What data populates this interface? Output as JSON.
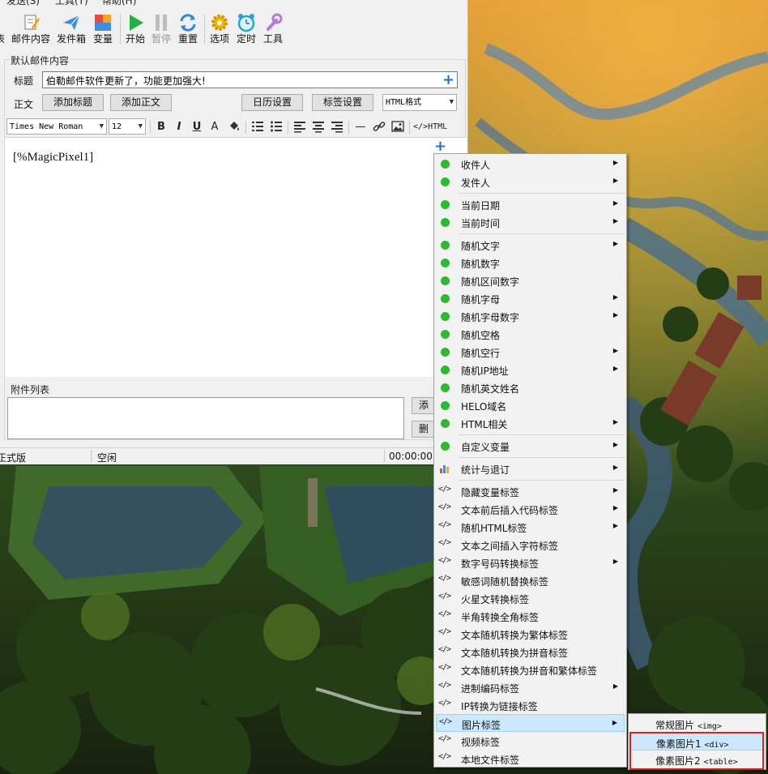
{
  "menubar": {
    "items": [
      "发送(S)",
      "工具(T)",
      "帮助(H)"
    ]
  },
  "toolbar": {
    "items": [
      {
        "label": "邮件内容",
        "icon": "edit-document-icon"
      },
      {
        "label": "发件箱",
        "icon": "send-plane-icon"
      },
      {
        "label": "变量",
        "icon": "variable-blocks-icon"
      },
      {
        "label": "开始",
        "icon": "play-icon"
      },
      {
        "label": "暂停",
        "icon": "pause-icon"
      },
      {
        "label": "重置",
        "icon": "reset-arrows-icon"
      },
      {
        "label": "选项",
        "icon": "gear-icon"
      },
      {
        "label": "定时",
        "icon": "alarm-clock-icon"
      },
      {
        "label": "工具",
        "icon": "wrench-icon"
      }
    ],
    "cut_label": "表"
  },
  "content_group": {
    "title": "默认邮件内容",
    "subject_label": "标题",
    "subject_value": "伯勒邮件软件更新了，功能更加强大!",
    "body_label": "正文",
    "add_title_button": "添加标题",
    "add_body_button": "添加正文",
    "calendar_button": "日历设置",
    "tag_button": "标签设置",
    "format_select": "HTML格式"
  },
  "editor_toolbar": {
    "font_select": "Times New Roman",
    "size_select": "12",
    "html_label": "HTML"
  },
  "editor": {
    "text": "[%MagicPixel1]"
  },
  "attachments": {
    "title": "附件列表",
    "add_button": "添",
    "delete_button": "删"
  },
  "statusbar": {
    "edition": "正式版",
    "state": "空闲",
    "timer": "00:00:00"
  },
  "context_menu": {
    "items": [
      {
        "label": "收件人",
        "icon": "green-dot-icon",
        "submenu": true
      },
      {
        "label": "发件人",
        "icon": "green-dot-icon",
        "submenu": true
      },
      {
        "label": "当前日期",
        "icon": "green-dot-icon",
        "submenu": true
      },
      {
        "label": "当前时间",
        "icon": "green-dot-icon",
        "submenu": true
      },
      {
        "label": "随机文字",
        "icon": "green-dot-icon",
        "submenu": true
      },
      {
        "label": "随机数字",
        "icon": "green-dot-icon",
        "submenu": false
      },
      {
        "label": "随机区间数字",
        "icon": "green-dot-icon",
        "submenu": false
      },
      {
        "label": "随机字母",
        "icon": "green-dot-icon",
        "submenu": true
      },
      {
        "label": "随机字母数字",
        "icon": "green-dot-icon",
        "submenu": true
      },
      {
        "label": "随机空格",
        "icon": "green-dot-icon",
        "submenu": false
      },
      {
        "label": "随机空行",
        "icon": "green-dot-icon",
        "submenu": true
      },
      {
        "label": "随机IP地址",
        "icon": "green-dot-icon",
        "submenu": true
      },
      {
        "label": "随机英文姓名",
        "icon": "green-dot-icon",
        "submenu": false
      },
      {
        "label": "HELO域名",
        "icon": "green-dot-icon",
        "submenu": false
      },
      {
        "label": "HTML相关",
        "icon": "green-dot-icon",
        "submenu": true
      },
      {
        "label": "自定义变量",
        "icon": "green-dot-icon",
        "submenu": true
      },
      {
        "label": "统计与退订",
        "icon": "bar-chart-icon",
        "submenu": true
      },
      {
        "label": "隐藏变量标签",
        "icon": "code-tag-icon",
        "submenu": true
      },
      {
        "label": "文本前后插入代码标签",
        "icon": "code-tag-icon",
        "submenu": true
      },
      {
        "label": "随机HTML标签",
        "icon": "code-tag-icon",
        "submenu": true
      },
      {
        "label": "文本之间插入字符标签",
        "icon": "code-tag-icon",
        "submenu": false
      },
      {
        "label": "数字号码转换标签",
        "icon": "code-tag-icon",
        "submenu": true
      },
      {
        "label": "敏感词随机替换标签",
        "icon": "code-tag-icon",
        "submenu": false
      },
      {
        "label": "火星文转换标签",
        "icon": "code-tag-icon",
        "submenu": false
      },
      {
        "label": "半角转换全角标签",
        "icon": "code-tag-icon",
        "submenu": false
      },
      {
        "label": "文本随机转换为繁体标签",
        "icon": "code-tag-icon",
        "submenu": false
      },
      {
        "label": "文本随机转换为拼音标签",
        "icon": "code-tag-icon",
        "submenu": false
      },
      {
        "label": "文本随机转换为拼音和繁体标签",
        "icon": "code-tag-icon",
        "submenu": false
      },
      {
        "label": "进制编码标签",
        "icon": "code-tag-icon",
        "submenu": true
      },
      {
        "label": "IP转换为链接标签",
        "icon": "code-tag-icon",
        "submenu": false
      },
      {
        "label": "图片标签",
        "icon": "code-tag-icon",
        "submenu": true,
        "highlighted": true
      },
      {
        "label": "视频标签",
        "icon": "code-tag-icon",
        "submenu": false
      },
      {
        "label": "本地文件标签",
        "icon": "code-tag-icon",
        "submenu": false
      }
    ],
    "code_glyph": "</>",
    "submenu_glyph": "▶"
  },
  "image_submenu": {
    "items": [
      {
        "label": "常规图片",
        "tag": "<img>"
      },
      {
        "label": "像素图片1",
        "tag": "<div>",
        "highlighted": true
      },
      {
        "label": "像素图片2",
        "tag": "<table>"
      }
    ]
  },
  "colors": {
    "accent": "#1e73d8",
    "highlight": "#cce8ff",
    "dot": "#2dbb2d",
    "annotation": "#e02020"
  }
}
